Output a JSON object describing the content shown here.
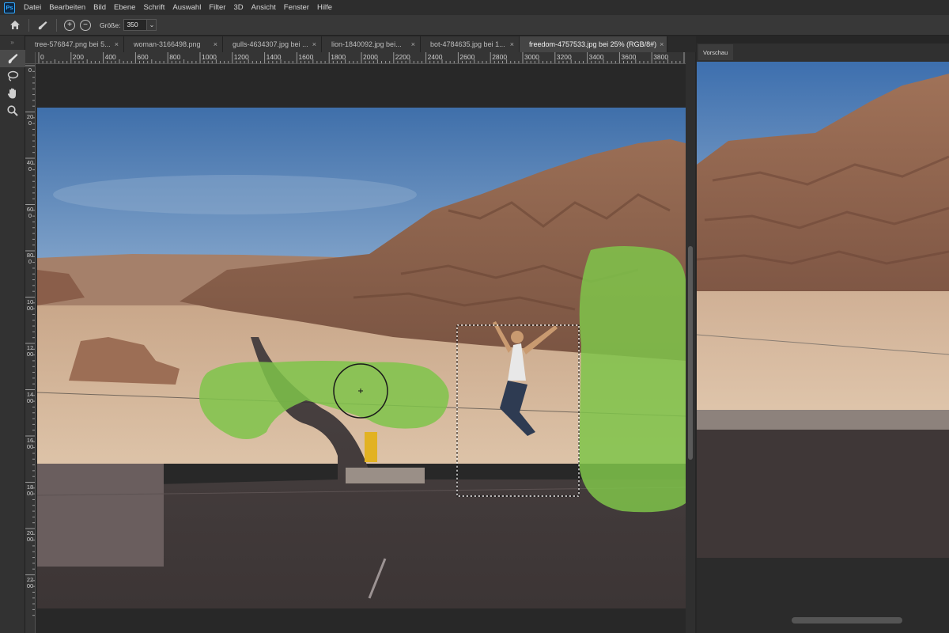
{
  "menu": {
    "app_icon": "Ps",
    "items": [
      "Datei",
      "Bearbeiten",
      "Bild",
      "Ebene",
      "Schrift",
      "Auswahl",
      "Filter",
      "3D",
      "Ansicht",
      "Fenster",
      "Hilfe"
    ]
  },
  "options": {
    "size_label": "Größe:",
    "size_value": "350",
    "add_symbol": "+",
    "subtract_symbol": "−"
  },
  "tabs": [
    {
      "label": "tree-576847.png bei 5...",
      "active": false
    },
    {
      "label": "woman-3166498.png",
      "active": false
    },
    {
      "label": "gulls-4634307.jpg bei ...",
      "active": false
    },
    {
      "label": "lion-1840092.jpg bei...",
      "active": false
    },
    {
      "label": "bot-4784635.jpg bei 1...",
      "active": false
    },
    {
      "label": "freedom-4757533.jpg bei 25% (RGB/8#)",
      "active": true
    }
  ],
  "tab_close": "×",
  "ruler": {
    "h_labels": [
      "0",
      "200",
      "400",
      "600",
      "800",
      "1000",
      "1200",
      "1400",
      "1600",
      "1800",
      "2000",
      "2200",
      "2400",
      "2600",
      "2800",
      "3000",
      "3200",
      "3400",
      "3600",
      "3800",
      "4000"
    ],
    "v_labels": [
      "0",
      "200",
      "400",
      "600",
      "800",
      "1000",
      "1200",
      "1400",
      "1600",
      "1800",
      "2000",
      "2200"
    ]
  },
  "preview": {
    "tab_label": "Vorschau"
  },
  "colors": {
    "accent": "#31a8ff",
    "mask_green": "#7fc44a",
    "sky": "#4a7bb5"
  }
}
